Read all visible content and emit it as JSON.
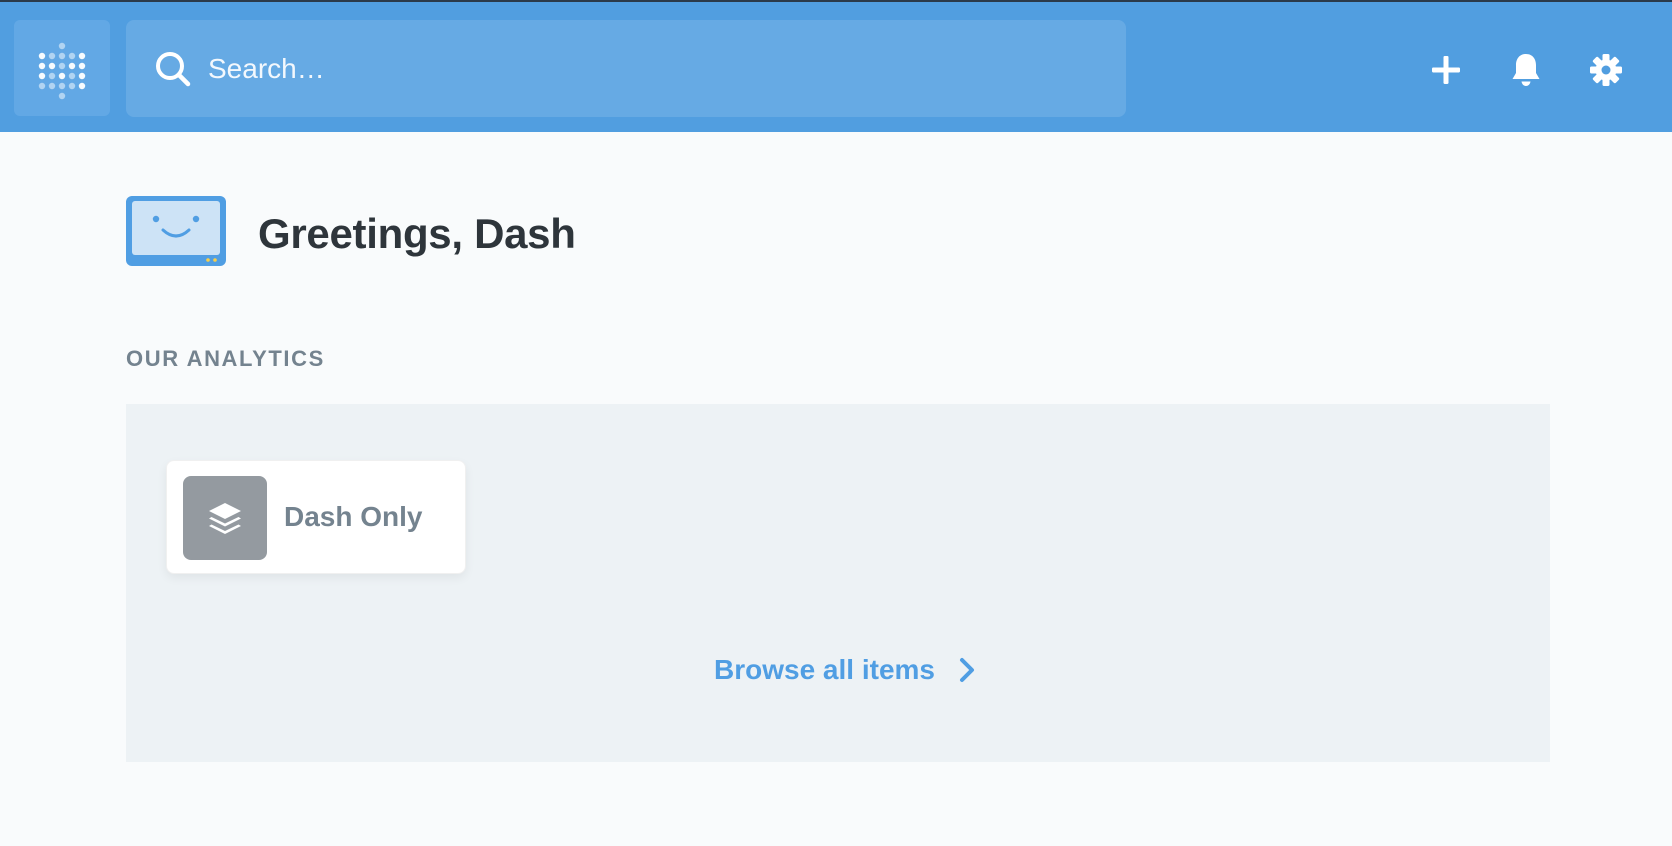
{
  "header": {
    "logo_icon": "metabase-logo-icon",
    "search": {
      "placeholder": "Search…",
      "value": "",
      "icon": "search-icon"
    },
    "actions": [
      {
        "name": "new",
        "icon": "plus-icon"
      },
      {
        "name": "notifications",
        "icon": "bell-icon"
      },
      {
        "name": "settings",
        "icon": "gear-icon"
      }
    ],
    "background_color": "#519EE0"
  },
  "greeting": {
    "text": "Greetings, Dash",
    "avatar_icon": "smiling-screen-icon"
  },
  "our_analytics": {
    "section_title": "OUR ANALYTICS",
    "collections": [
      {
        "name": "Dash Only",
        "icon": "collection-layers-icon",
        "icon_bg_color": "#949AA0"
      }
    ],
    "browse_link": {
      "label": "Browse all items",
      "icon": "chevron-right-icon",
      "color": "#509EE3"
    }
  }
}
